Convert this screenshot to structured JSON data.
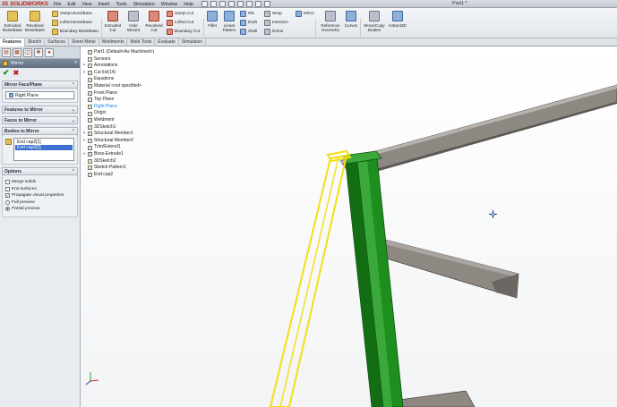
{
  "app": {
    "brand": "SOLIDWORKS",
    "brand_prefix": "3S",
    "document_title": "Part1 *"
  },
  "menu": [
    "File",
    "Edit",
    "View",
    "Insert",
    "Tools",
    "Simulation",
    "Window",
    "Help"
  ],
  "commands": {
    "extruded_boss": "Extruded Boss/Base",
    "revolved_boss": "Revolved Boss/Base",
    "swept_boss": "Swept Boss/Base",
    "lofted_boss": "Lofted Boss/Base",
    "boundary_boss": "Boundary Boss/Base",
    "extruded_cut": "Extruded Cut",
    "hole_wizard": "Hole Wizard",
    "revolved_cut": "Revolved Cut",
    "swept_cut": "Swept Cut",
    "lofted_cut": "Lofted Cut",
    "boundary_cut": "Boundary Cut",
    "fillet": "Fillet",
    "linear_pattern": "Linear Pattern",
    "rib": "Rib",
    "draft": "Draft",
    "shell": "Shell",
    "wrap": "Wrap",
    "intersect": "Intersect",
    "dome": "Dome",
    "mirror": "Mirror",
    "reference_geometry": "Reference Geometry",
    "curves": "Curves",
    "move_copy_bodies": "Move/Copy Bodies",
    "instant3d": "Instant3D"
  },
  "tabs": [
    "Features",
    "Sketch",
    "Surfaces",
    "Sheet Metal",
    "Weldments",
    "Mold Tools",
    "Evaluate",
    "Simulation"
  ],
  "active_tab": "Features",
  "property_manager": {
    "title": "Mirror",
    "help": "?",
    "mirror_face_plane": {
      "heading": "Mirror Face/Plane",
      "value": "Right Plane"
    },
    "features_to_mirror": "Features to Mirror",
    "faces_to_mirror": "Faces to Mirror",
    "bodies_to_mirror": {
      "heading": "Bodies to Mirror",
      "items": [
        "End cap2[1]",
        "End cap2[2]"
      ],
      "selected_index": 1
    },
    "options": {
      "heading": "Options",
      "merge_solids": "Merge solids",
      "knit_surfaces": "Knit surfaces",
      "propagate_visual": "Propagate visual properties",
      "full_preview": "Full preview",
      "partial_preview": "Partial preview",
      "merge_solids_checked": false,
      "knit_surfaces_checked": false,
      "propagate_visual_checked": true,
      "preview_mode": "partial"
    }
  },
  "feature_tree": [
    {
      "label": "Part1 (Default<As Machined>)",
      "expand": "",
      "highlight": false
    },
    {
      "label": "Sensors",
      "expand": "",
      "highlight": false
    },
    {
      "label": "Annotations",
      "expand": "+",
      "highlight": false
    },
    {
      "label": "Cut list(14)",
      "expand": "+",
      "highlight": false
    },
    {
      "label": "Equations",
      "expand": "",
      "highlight": false
    },
    {
      "label": "Material <not specified>",
      "expand": "",
      "highlight": false
    },
    {
      "label": "Front Plane",
      "expand": "",
      "highlight": false
    },
    {
      "label": "Top Plane",
      "expand": "",
      "highlight": false
    },
    {
      "label": "Right Plane",
      "expand": "",
      "highlight": true
    },
    {
      "label": "Origin",
      "expand": "",
      "highlight": false
    },
    {
      "label": "Weldment",
      "expand": "",
      "highlight": false
    },
    {
      "label": "3DSketch1",
      "expand": "",
      "highlight": false
    },
    {
      "label": "Structural Member1",
      "expand": "+",
      "highlight": false
    },
    {
      "label": "Structural Member2",
      "expand": "+",
      "highlight": false
    },
    {
      "label": "Trim/Extend1",
      "expand": "",
      "highlight": false
    },
    {
      "label": "Boss-Extrude1",
      "expand": "+",
      "highlight": false
    },
    {
      "label": "3DSketch2",
      "expand": "",
      "highlight": false
    },
    {
      "label": "Sketch-Pattern1",
      "expand": "",
      "highlight": false
    },
    {
      "label": "End cap2",
      "expand": "",
      "highlight": false
    }
  ],
  "colors": {
    "selected_body": "#f2df14",
    "preview_body": "#1e8f1e",
    "steel": "#8e8883",
    "highlight_text": "#1e88e5"
  },
  "icons": {
    "ok": "check-icon",
    "cancel": "close-icon",
    "cursor": "move-cursor-icon",
    "triad": "axis-triad-icon"
  }
}
